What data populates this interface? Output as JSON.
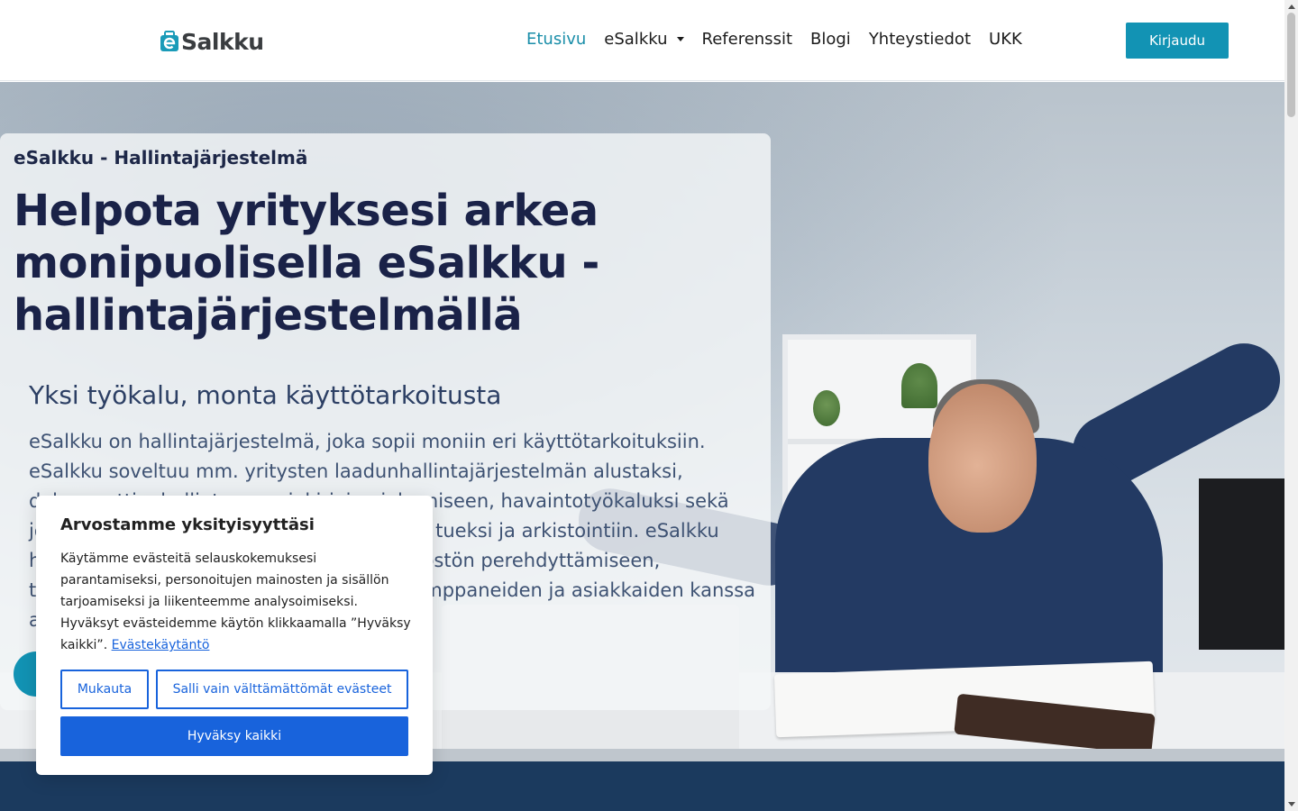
{
  "header": {
    "logo_text": "Salkku",
    "nav": [
      {
        "label": "Etusivu",
        "active": true
      },
      {
        "label": "eSalkku",
        "dropdown": true
      },
      {
        "label": "Referenssit"
      },
      {
        "label": "Blogi"
      },
      {
        "label": "Yhteystiedot"
      },
      {
        "label": "UKK"
      }
    ],
    "login_label": "Kirjaudu"
  },
  "hero": {
    "eyebrow": "eSalkku - Hallintajärjestelmä",
    "title": "Helpota yrityksesi arkea monipuolisella eSalkku - hallintajärjestelmällä",
    "subtitle": "Yksi työkalu, monta käyttötarkoitusta",
    "text": "eSalkku on hallintajärjestelmä, joka sopii moniin eri käyttötarkoituksiin. eSalkku soveltuu mm. yritysten laadunhallintajärjestelmän alustaksi, dokumenttienhallintaan, asiakirjojen jakamiseen, havaintotyökaluksi sekä johtoryhmätyöskentelyn ja päätöksenteon tueksi ja arkistointiin. eSalkku hallintajärjestelmä käy myös hyvin henkilöstön perehdyttämiseen, tiedotteiden jakamiseen sekä yhteistyökumppaneiden ja asiakkaiden kanssa asiointiin."
  },
  "cookie": {
    "title": "Arvostamme yksityisyyttäsi",
    "text": "Käytämme evästeitä selauskokemuksesi parantamiseksi, personoitujen mainosten ja sisällön tarjoamiseksi ja liikenteemme analysoimiseksi. Hyväksyt evästeidemme käytön klikkaamalla ”Hyväksy kaikki”.",
    "link": "Evästekäytäntö",
    "customize": "Mukauta",
    "necessary_only": "Salli vain välttämättömät evästeet",
    "accept_all": "Hyväksy kaikki"
  },
  "colors": {
    "brand": "#1293b4",
    "nav_active": "#1a8ea9",
    "cookie_primary": "#1863dc",
    "heading": "#1a2248"
  }
}
